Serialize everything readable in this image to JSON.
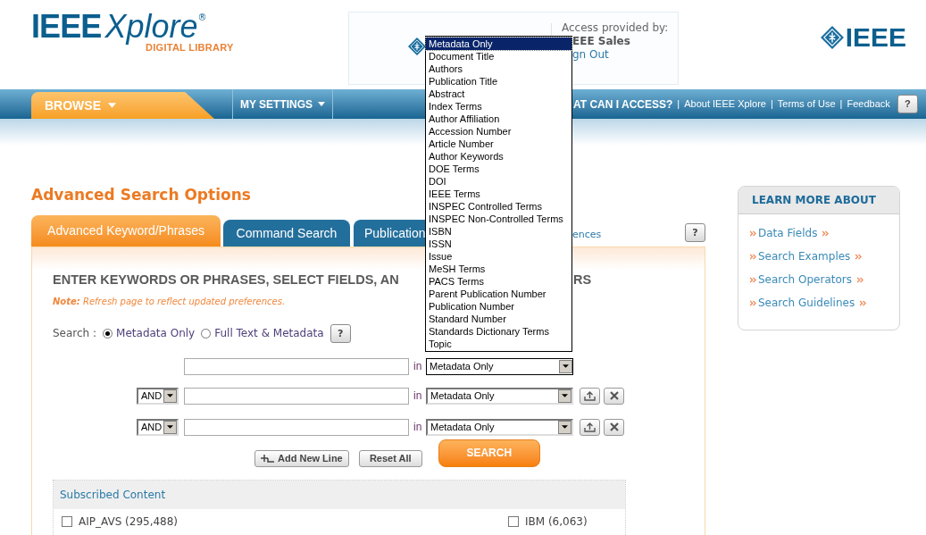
{
  "header": {
    "logo_word": "IEEE",
    "logo_script": "Xplore",
    "logo_mark": "®",
    "logo_subtitle": "DIGITAL LIBRARY",
    "access_label": "Access provided by:",
    "access_org": "EEE Sales",
    "sign_out": "gn Out",
    "brand": "IEEE"
  },
  "nav": {
    "menus": [
      {
        "label": "BROWSE",
        "selected": true
      },
      {
        "label": "MY SETTINGS",
        "selected": false
      }
    ],
    "links": [
      {
        "label": "AT CAN I ACCESS?",
        "kind": "strong"
      },
      {
        "label": "About IEEE Xplore",
        "kind": "plain"
      },
      {
        "label": "Terms of Use",
        "kind": "plain"
      },
      {
        "label": "Feedback",
        "kind": "plain"
      }
    ],
    "separators": [
      "|",
      "|",
      "|"
    ],
    "help": "?"
  },
  "page_title": "Advanced Search Options",
  "tabs": [
    {
      "label": "Advanced Keyword/Phrases",
      "selected": true
    },
    {
      "label": "Command Search",
      "selected": false
    },
    {
      "label": "Publication",
      "selected": false
    }
  ],
  "preferences_link": "ences",
  "tabs_help": "?",
  "form": {
    "heading": "ENTER KEYWORDS OR PHRASES, SELECT FIELDS, AN",
    "heading_end": "RS",
    "note": "**Note:** Refresh page to reflect updated preferences.",
    "search_label": "Search :",
    "scope": [
      {
        "label": "Metadata Only",
        "selected": true
      },
      {
        "label": "Full Text & Metadata",
        "selected": false
      }
    ],
    "scope_help": "?",
    "rows": [
      {
        "in": "in",
        "field": "Metadata Only",
        "open": true,
        "actions": false
      },
      {
        "operator": "AND",
        "in": "in",
        "field": "Metadata Only",
        "open": false,
        "actions": true
      },
      {
        "operator": "AND",
        "in": "in",
        "field": "Metadata Only",
        "open": false,
        "actions": true
      }
    ],
    "field_options": [
      {
        "label": "Metadata Only",
        "selected": true
      },
      {
        "label": "Document Title",
        "selected": false
      },
      {
        "label": "Authors",
        "selected": false
      },
      {
        "label": "Publication Title",
        "selected": false
      },
      {
        "label": "Abstract",
        "selected": false
      },
      {
        "label": "Index Terms",
        "selected": false
      },
      {
        "label": "Author Affiliation",
        "selected": false
      },
      {
        "label": "Accession Number",
        "selected": false
      },
      {
        "label": "Article Number",
        "selected": false
      },
      {
        "label": "Author Keywords",
        "selected": false
      },
      {
        "label": "DOE Terms",
        "selected": false
      },
      {
        "label": "DOI",
        "selected": false
      },
      {
        "label": "IEEE Terms",
        "selected": false
      },
      {
        "label": "INSPEC Controlled Terms",
        "selected": false
      },
      {
        "label": "INSPEC Non-Controlled Terms",
        "selected": false
      },
      {
        "label": "ISBN",
        "selected": false
      },
      {
        "label": "ISSN",
        "selected": false
      },
      {
        "label": "Issue",
        "selected": false
      },
      {
        "label": "MeSH Terms",
        "selected": false
      },
      {
        "label": "PACS Terms",
        "selected": false
      },
      {
        "label": "Parent Publication Number",
        "selected": false
      },
      {
        "label": "Publication Number",
        "selected": false
      },
      {
        "label": "Standard Number",
        "selected": false
      },
      {
        "label": "Standards Dictionary Terms",
        "selected": false
      },
      {
        "label": "Topic",
        "selected": false
      }
    ],
    "buttons": {
      "add": "Add New Line",
      "reset": "Reset All",
      "search": "SEARCH"
    }
  },
  "subscribed": {
    "title": "Subscribed Content",
    "items": [
      {
        "label": "AIP_AVS (295,488)",
        "checked": false
      },
      {
        "label": "IBM (6,063)",
        "checked": false
      }
    ]
  },
  "sidebar": {
    "title": "LEARN MORE ABOUT",
    "links": [
      "Data Fields",
      "Search Examples",
      "Search Operators",
      "Search Guidelines"
    ]
  }
}
